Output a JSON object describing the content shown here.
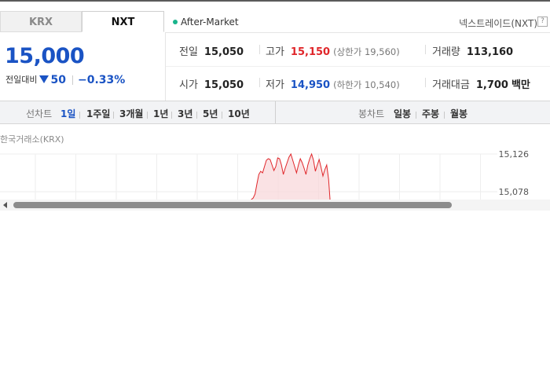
{
  "tabs": [
    {
      "label": "KRX",
      "active": false
    },
    {
      "label": "NXT",
      "active": true
    }
  ],
  "market_status": "After-Market",
  "exchange_label": "넥스트레이드(NXT)",
  "help_icon": "?",
  "price": {
    "current": "15,000",
    "change_label": "전일대비",
    "change_value": "50",
    "change_direction": "down",
    "change_percent": "−0.33%"
  },
  "stats": {
    "prev_close": {
      "label": "전일",
      "value": "15,050"
    },
    "high": {
      "label": "고가",
      "value": "15,150",
      "limit_label": "(상한가 19,560)"
    },
    "volume": {
      "label": "거래량",
      "value": "113,160"
    },
    "open": {
      "label": "시가",
      "value": "15,050"
    },
    "low": {
      "label": "저가",
      "value": "14,950",
      "limit_label": "(하한가 10,540)"
    },
    "trade_value": {
      "label": "거래대금",
      "value": "1,700",
      "unit": "백만"
    }
  },
  "toolbar": {
    "line_chart_label": "선차트",
    "periods": [
      "1일",
      "1주일",
      "3개월",
      "1년",
      "3년",
      "5년",
      "10년"
    ],
    "active_period": "1일",
    "candle_chart_label": "봉차트",
    "candle_periods": [
      "일봉",
      "주봉",
      "월봉"
    ]
  },
  "chart_data": {
    "type": "area",
    "title": "한국거래소(KRX)",
    "y_ticks": [
      "15,126",
      "15,078"
    ],
    "ylim": [
      15040,
      15140
    ],
    "series_color": "#e0262a",
    "x": [
      41,
      42,
      43,
      44,
      45,
      46,
      47,
      48,
      49,
      50,
      51,
      52,
      53,
      54,
      55,
      56,
      57,
      58,
      59,
      60,
      61,
      62,
      63,
      64,
      65,
      66,
      67,
      68,
      69,
      70,
      71,
      72,
      73,
      74,
      75,
      76,
      77,
      78,
      79,
      80,
      81,
      82,
      83,
      84,
      85
    ],
    "values": [
      15060,
      15062,
      15068,
      15070,
      15075,
      15088,
      15100,
      15104,
      15102,
      15110,
      15118,
      15120,
      15119,
      15112,
      15105,
      15110,
      15121,
      15120,
      15112,
      15100,
      15108,
      15115,
      15122,
      15126,
      15118,
      15110,
      15102,
      15112,
      15120,
      15115,
      15108,
      15100,
      15112,
      15120,
      15126,
      15118,
      15104,
      15112,
      15119,
      15109,
      15098,
      15106,
      15112,
      15094,
      15060
    ],
    "grid": true
  },
  "colors": {
    "up": "#e0262a",
    "down": "#1a53c4",
    "accent": "#1a53c4"
  }
}
